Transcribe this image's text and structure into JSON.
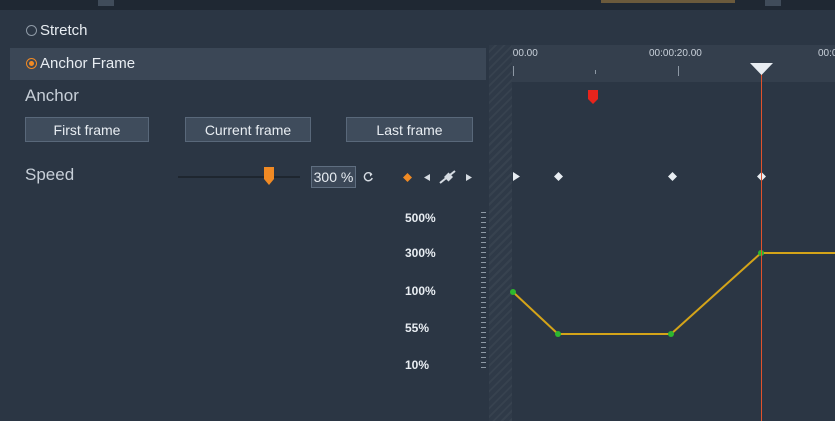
{
  "options": {
    "stretch_label": "Stretch",
    "anchor_frame_label": "Anchor Frame",
    "selected": "Anchor Frame"
  },
  "anchor": {
    "section_label": "Anchor",
    "buttons": {
      "first": "First frame",
      "current": "Current frame",
      "last": "Last frame"
    }
  },
  "speed": {
    "section_label": "Speed",
    "value_text": "300 %",
    "slider_value_percent": 300
  },
  "timeline": {
    "timecodes": [
      ":00.00",
      "00:00:20.00",
      "00:0"
    ],
    "y_axis_labels": [
      "500%",
      "300%",
      "100%",
      "55%",
      "10%"
    ],
    "keyframe_speeds_percent": [
      100,
      55,
      55,
      300,
      300
    ]
  },
  "colors": {
    "accent": "#f08a24",
    "curve": "#d4a419",
    "keyframe_point": "#2eb82e",
    "playhead": "#e0522c",
    "anchor_marker": "#e8241c"
  }
}
